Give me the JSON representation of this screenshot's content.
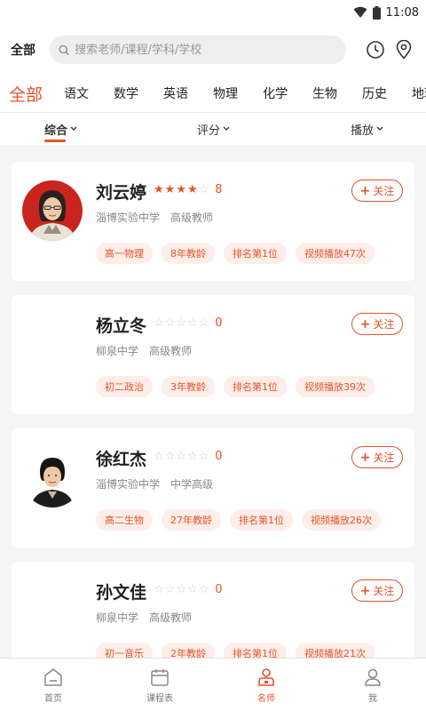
{
  "status_bar": {
    "time": "11:08",
    "wifi_icon": "wifi-icon",
    "battery_icon": "battery-icon"
  },
  "header": {
    "scope_label": "全部",
    "search_placeholder": "搜索老师/课程/学科/学校",
    "history_icon": "clock-icon",
    "location_icon": "location-pin-icon"
  },
  "subject_tabs": [
    {
      "label": "全部",
      "active": true
    },
    {
      "label": "语文"
    },
    {
      "label": "数学"
    },
    {
      "label": "英语"
    },
    {
      "label": "物理"
    },
    {
      "label": "化学"
    },
    {
      "label": "生物"
    },
    {
      "label": "历史"
    },
    {
      "label": "地理"
    }
  ],
  "sort_bar": {
    "items": [
      {
        "label": "综合",
        "active": true
      },
      {
        "label": "评分"
      },
      {
        "label": "播放"
      }
    ]
  },
  "teachers": [
    {
      "name": "刘云婷",
      "stars": 4,
      "rating": "8",
      "school": "淄博实验中学",
      "title": "高级教师",
      "tags": [
        "高一物理",
        "8年教龄",
        "排名第1位",
        "视频播放47次"
      ],
      "follow_label": "关注",
      "has_photo": true
    },
    {
      "name": "杨立冬",
      "stars": 0,
      "rating": "0",
      "school": "柳泉中学",
      "title": "高级教师",
      "tags": [
        "初二政治",
        "3年教龄",
        "排名第1位",
        "视频播放39次"
      ],
      "follow_label": "关注",
      "has_photo": false
    },
    {
      "name": "徐红杰",
      "stars": 0,
      "rating": "0",
      "school": "淄博实验中学",
      "title": "中学高级",
      "tags": [
        "高二生物",
        "27年教龄",
        "排名第1位",
        "视频播放26次"
      ],
      "follow_label": "关注",
      "has_photo": true
    },
    {
      "name": "孙文佳",
      "stars": 0,
      "rating": "0",
      "school": "柳泉中学",
      "title": "高级教师",
      "tags": [
        "初一音乐",
        "2年教龄",
        "排名第1位",
        "视频播放21次"
      ],
      "follow_label": "关注",
      "has_photo": false
    }
  ],
  "bottom_nav": [
    {
      "label": "首页",
      "icon": "home-icon"
    },
    {
      "label": "课程表",
      "icon": "calendar-icon"
    },
    {
      "label": "名师",
      "icon": "teacher-icon",
      "active": true
    },
    {
      "label": "我",
      "icon": "user-icon"
    }
  ],
  "colors": {
    "accent": "#e8512b",
    "tag_bg": "#fdeee8",
    "page_bg": "#f5f5f5"
  }
}
